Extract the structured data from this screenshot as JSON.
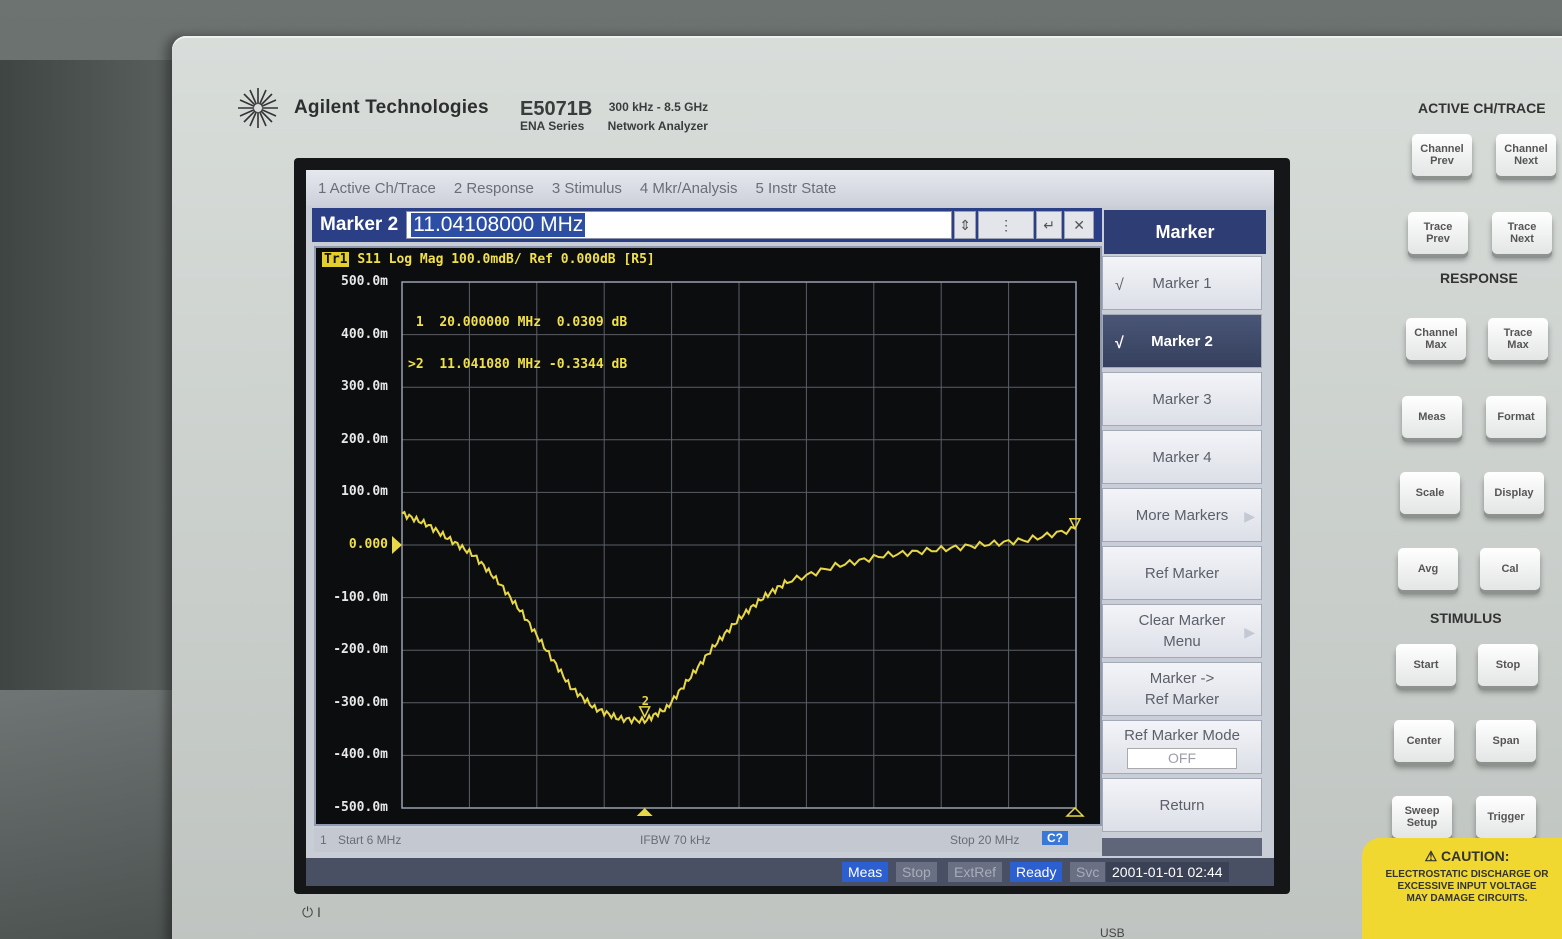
{
  "instrument": {
    "brand": "Agilent Technologies",
    "model": "E5071B",
    "range": "300 kHz - 8.5 GHz",
    "series": "ENA  Series",
    "type": "Network Analyzer"
  },
  "menu_tabs": [
    "1 Active Ch/Trace",
    "2 Response",
    "3 Stimulus",
    "4 Mkr/Analysis",
    "5 Instr State"
  ],
  "entry": {
    "label": "Marker 2",
    "value": "11.04108000 MHz"
  },
  "softkey_menu": {
    "title": "Marker",
    "keys": [
      {
        "label": "Marker 1",
        "check": "√",
        "active": false
      },
      {
        "label": "Marker 2",
        "check": "√",
        "active": true
      },
      {
        "label": "Marker 3"
      },
      {
        "label": "Marker 4"
      },
      {
        "label": "More Markers",
        "arrow": true
      },
      {
        "label": "Ref Marker"
      },
      {
        "label": "Clear Marker\nMenu",
        "arrow": true
      },
      {
        "label": "Marker ->\nRef Marker"
      },
      {
        "label": "Ref Marker Mode",
        "sub": "OFF"
      },
      {
        "label": "Return"
      }
    ]
  },
  "trace": {
    "badge": "Tr1",
    "header": "S11 Log Mag 100.0mdB/ Ref 0.000dB [R5]",
    "markers": [
      {
        "id": "1",
        "prefix": " ",
        "freq": "20.000000 MHz",
        "value": "0.0309 dB"
      },
      {
        "id": "2",
        "prefix": ">",
        "freq": "11.041080 MHz",
        "value": "-0.3344 dB"
      }
    ],
    "marker_on_plot": "2"
  },
  "y_ticks": [
    "500.0m",
    "400.0m",
    "300.0m",
    "200.0m",
    "100.0m",
    "0.000",
    "-100.0m",
    "-200.0m",
    "-300.0m",
    "-400.0m",
    "-500.0m"
  ],
  "footer": {
    "channel": "1",
    "start": "Start 6 MHz",
    "ifbw": "IFBW 70 kHz",
    "stop": "Stop 20 MHz",
    "cal_badge": "C?"
  },
  "status": {
    "meas": "Meas",
    "stop": "Stop",
    "extref": "ExtRef",
    "ready": "Ready",
    "svc": "Svc",
    "datetime": "2001-01-01 02:44"
  },
  "hardkeys": {
    "active_ch_trace_title": "ACTIVE CH/TRACE",
    "response_title": "RESPONSE",
    "stimulus_title": "STIMULUS",
    "channel_prev": "Channel\nPrev",
    "channel_next": "Channel\nNext",
    "trace_prev": "Trace\nPrev",
    "trace_next": "Trace\nNext",
    "channel_max": "Channel\nMax",
    "trace_max": "Trace\nMax",
    "meas": "Meas",
    "format": "Format",
    "scale": "Scale",
    "display": "Display",
    "avg": "Avg",
    "cal": "Cal",
    "start": "Start",
    "stop": "Stop",
    "center": "Center",
    "span": "Span",
    "sweep_setup": "Sweep\nSetup",
    "trigger": "Trigger"
  },
  "caution": {
    "title": "⚠ CAUTION:",
    "text": "ELECTROSTATIC DISCHARGE OR\nEXCESSIVE INPUT VOLTAGE\nMAY DAMAGE CIRCUITS."
  },
  "power_symbol": "⏻ I",
  "usb_label": "USB",
  "colors": {
    "trace": "#e8d848",
    "grid": "#5a5e66",
    "screen_bg": "#0c0d0f",
    "menu_title_bg": "#2e3d74",
    "status_ready": "#2c5fd0"
  },
  "chart_data": {
    "type": "line",
    "title": "S11 Log Mag 100.0mdB/ Ref 0.000dB [R5]",
    "xlabel": "",
    "ylabel": "",
    "xlim": [
      6,
      20
    ],
    "ylim": [
      -0.5,
      0.5
    ],
    "x_unit": "MHz",
    "y_unit": "dB",
    "series": [
      {
        "x": [
          6.0,
          6.5,
          7.0,
          7.5,
          8.0,
          8.5,
          9.0,
          9.5,
          10.0,
          10.5,
          11.04,
          11.5,
          12.0,
          12.5,
          13.0,
          13.5,
          14.0,
          15.0,
          16.0,
          17.0,
          18.0,
          19.0,
          20.0
        ],
        "y": [
          0.06,
          0.04,
          0.01,
          -0.02,
          -0.07,
          -0.13,
          -0.2,
          -0.27,
          -0.31,
          -0.33,
          -0.3344,
          -0.31,
          -0.25,
          -0.19,
          -0.14,
          -0.1,
          -0.07,
          -0.04,
          -0.02,
          -0.01,
          0.0,
          0.01,
          0.0309
        ]
      }
    ],
    "markers": [
      {
        "id": "1",
        "x": 20.0,
        "y": 0.0309
      },
      {
        "id": "2",
        "x": 11.04108,
        "y": -0.3344
      }
    ],
    "grid": true
  }
}
